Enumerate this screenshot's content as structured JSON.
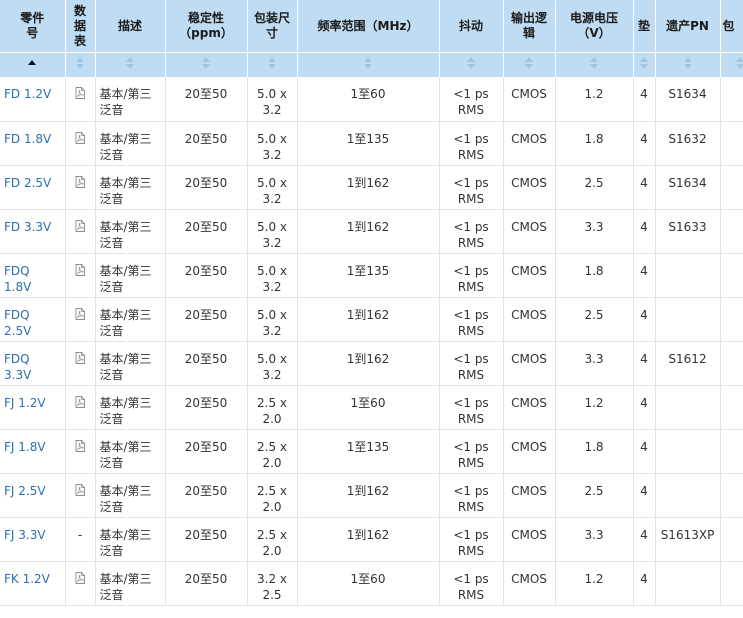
{
  "columns": [
    {
      "key": "part",
      "label": "零件\n号"
    },
    {
      "key": "datasheet",
      "label": "数\n据\n表"
    },
    {
      "key": "desc",
      "label": "描述"
    },
    {
      "key": "stability",
      "label": "稳定性\n（ppm）"
    },
    {
      "key": "package",
      "label": "包装尺\n寸"
    },
    {
      "key": "freq",
      "label": "频率范围（MHz）"
    },
    {
      "key": "jitter",
      "label": "抖动"
    },
    {
      "key": "logic",
      "label": "输出逻\n辑"
    },
    {
      "key": "voltage",
      "label": "电源电压\n（V）"
    },
    {
      "key": "pads",
      "label": "垫"
    },
    {
      "key": "legacy",
      "label": "遗产PN"
    },
    {
      "key": "pkg2",
      "label": "包"
    }
  ],
  "colors": {
    "header_bg": "#bfdcf2",
    "link": "#2a6fb5",
    "sort_icon": "#a7c3d8",
    "sort_active": "#111111"
  },
  "rows": [
    {
      "part": "FD 1.2V",
      "datasheet": "pdf",
      "desc": "基本/第三\n泛音",
      "stability": "20至50",
      "package": "5.0 x\n3.2",
      "freq": "1至60",
      "jitter": "<1 ps\nRMS",
      "logic": "CMOS",
      "voltage": "1.2",
      "pads": "4",
      "legacy": "S1634"
    },
    {
      "part": "FD 1.8V",
      "datasheet": "pdf",
      "desc": "基本/第三\n泛音",
      "stability": "20至50",
      "package": "5.0 x\n3.2",
      "freq": "1至135",
      "jitter": "<1 ps\nRMS",
      "logic": "CMOS",
      "voltage": "1.8",
      "pads": "4",
      "legacy": "S1632"
    },
    {
      "part": "FD 2.5V",
      "datasheet": "pdf",
      "desc": "基本/第三\n泛音",
      "stability": "20至50",
      "package": "5.0 x\n3.2",
      "freq": "1到162",
      "jitter": "<1 ps\nRMS",
      "logic": "CMOS",
      "voltage": "2.5",
      "pads": "4",
      "legacy": "S1634"
    },
    {
      "part": "FD 3.3V",
      "datasheet": "pdf",
      "desc": "基本/第三\n泛音",
      "stability": "20至50",
      "package": "5.0 x\n3.2",
      "freq": "1到162",
      "jitter": "<1 ps\nRMS",
      "logic": "CMOS",
      "voltage": "3.3",
      "pads": "4",
      "legacy": "S1633"
    },
    {
      "part": "FDQ 1.8V",
      "datasheet": "pdf",
      "desc": "基本/第三\n泛音",
      "stability": "20至50",
      "package": "5.0 x\n3.2",
      "freq": "1至135",
      "jitter": "<1 ps\nRMS",
      "logic": "CMOS",
      "voltage": "1.8",
      "pads": "4",
      "legacy": ""
    },
    {
      "part": "FDQ 2.5V",
      "datasheet": "pdf",
      "desc": "基本/第三\n泛音",
      "stability": "20至50",
      "package": "5.0 x\n3.2",
      "freq": "1到162",
      "jitter": "<1 ps\nRMS",
      "logic": "CMOS",
      "voltage": "2.5",
      "pads": "4",
      "legacy": ""
    },
    {
      "part": "FDQ 3.3V",
      "datasheet": "pdf",
      "desc": "基本/第三\n泛音",
      "stability": "20至50",
      "package": "5.0 x\n3.2",
      "freq": "1到162",
      "jitter": "<1 ps\nRMS",
      "logic": "CMOS",
      "voltage": "3.3",
      "pads": "4",
      "legacy": "S1612"
    },
    {
      "part": "FJ 1.2V",
      "datasheet": "pdf",
      "desc": "基本/第三\n泛音",
      "stability": "20至50",
      "package": "2.5 x\n2.0",
      "freq": "1至60",
      "jitter": "<1 ps\nRMS",
      "logic": "CMOS",
      "voltage": "1.2",
      "pads": "4",
      "legacy": ""
    },
    {
      "part": "FJ 1.8V",
      "datasheet": "pdf",
      "desc": "基本/第三\n泛音",
      "stability": "20至50",
      "package": "2.5 x\n2.0",
      "freq": "1至135",
      "jitter": "<1 ps\nRMS",
      "logic": "CMOS",
      "voltage": "1.8",
      "pads": "4",
      "legacy": ""
    },
    {
      "part": "FJ 2.5V",
      "datasheet": "pdf",
      "desc": "基本/第三\n泛音",
      "stability": "20至50",
      "package": "2.5 x\n2.0",
      "freq": "1到162",
      "jitter": "<1 ps\nRMS",
      "logic": "CMOS",
      "voltage": "2.5",
      "pads": "4",
      "legacy": ""
    },
    {
      "part": "FJ 3.3V",
      "datasheet": "-",
      "desc": "基本/第三\n泛音",
      "stability": "20至50",
      "package": "2.5 x\n2.0",
      "freq": "1到162",
      "jitter": "<1 ps\nRMS",
      "logic": "CMOS",
      "voltage": "3.3",
      "pads": "4",
      "legacy": "S1613XP"
    },
    {
      "part": "FK 1.2V",
      "datasheet": "pdf",
      "desc": "基本/第三\n泛音",
      "stability": "20至50",
      "package": "3.2 x\n2.5",
      "freq": "1至60",
      "jitter": "<1 ps\nRMS",
      "logic": "CMOS",
      "voltage": "1.2",
      "pads": "4",
      "legacy": ""
    }
  ]
}
